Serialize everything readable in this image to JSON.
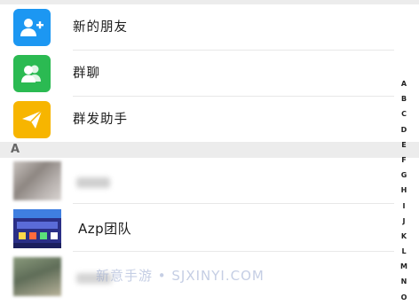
{
  "function_items": [
    {
      "label": "新的朋友",
      "icon": "add-friend-icon",
      "color": "#1c97f2"
    },
    {
      "label": "群聊",
      "icon": "group-chat-icon",
      "color": "#2bba52"
    },
    {
      "label": "群发助手",
      "icon": "broadcast-icon",
      "color": "#f7b500"
    }
  ],
  "section_letter": "A",
  "contacts": [
    {
      "name": "",
      "avatar": "blurred-avatar"
    },
    {
      "name": "Azp团队",
      "avatar": "azp-team-avatar"
    },
    {
      "name": "",
      "avatar": "blurred-avatar"
    }
  ],
  "index_letters": [
    "A",
    "B",
    "C",
    "D",
    "E",
    "F",
    "G",
    "H",
    "I",
    "J",
    "K",
    "L",
    "M",
    "N",
    "O"
  ],
  "watermark": "新意手游 • SJXINYI.COM"
}
